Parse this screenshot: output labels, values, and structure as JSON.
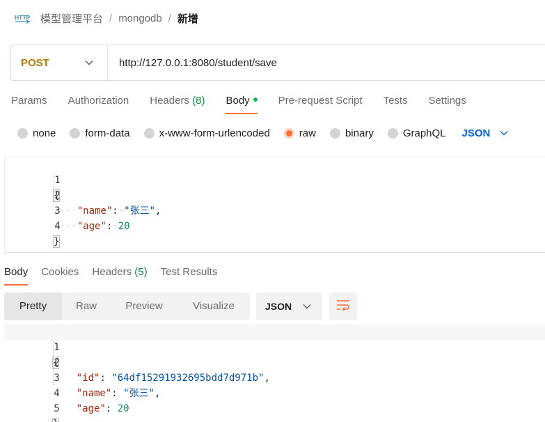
{
  "breadcrumb": {
    "items": [
      "模型管理平台",
      "mongodb"
    ],
    "current": "新增",
    "separator": "/"
  },
  "request": {
    "method": "POST",
    "url": "http://127.0.0.1:8080/student/save"
  },
  "request_tabs": [
    {
      "label": "Params"
    },
    {
      "label": "Authorization"
    },
    {
      "label": "Headers",
      "count": "(8)"
    },
    {
      "label": "Body",
      "active": true
    },
    {
      "label": "Pre-request Script"
    },
    {
      "label": "Tests"
    },
    {
      "label": "Settings"
    }
  ],
  "body_types": [
    {
      "label": "none",
      "checked": false
    },
    {
      "label": "form-data",
      "checked": false
    },
    {
      "label": "x-www-form-urlencoded",
      "checked": false
    },
    {
      "label": "raw",
      "checked": true
    },
    {
      "label": "binary",
      "checked": false
    },
    {
      "label": "GraphQL",
      "checked": false
    }
  ],
  "body_format": "JSON",
  "request_body": {
    "line_numbers": [
      "1",
      "2",
      "3",
      "4"
    ],
    "open_brace": "{",
    "close_brace": "}",
    "name_key": "\"name\"",
    "name_value": "\"张三\"",
    "age_key": "\"age\"",
    "age_value": "20"
  },
  "response_tabs": [
    {
      "label": "Body",
      "active": true
    },
    {
      "label": "Cookies"
    },
    {
      "label": "Headers",
      "count": "(5)"
    },
    {
      "label": "Test Results"
    }
  ],
  "response_views": [
    "Pretty",
    "Raw",
    "Preview",
    "Visualize"
  ],
  "response_format": "JSON",
  "response_body": {
    "line_numbers": [
      "1",
      "2",
      "3",
      "4",
      "5"
    ],
    "open_brace": "{",
    "close_brace": "}",
    "id_key": "\"id\"",
    "id_value": "\"64df15291932695bdd7d971b\"",
    "name_key": "\"name\"",
    "name_value": "\"张三\"",
    "age_key": "\"age\"",
    "age_value": "20"
  },
  "colors": {
    "accent": "#ff6c37",
    "method": "#ad7a03",
    "link_blue": "#0265d2",
    "count_green": "#0d8a3e"
  }
}
